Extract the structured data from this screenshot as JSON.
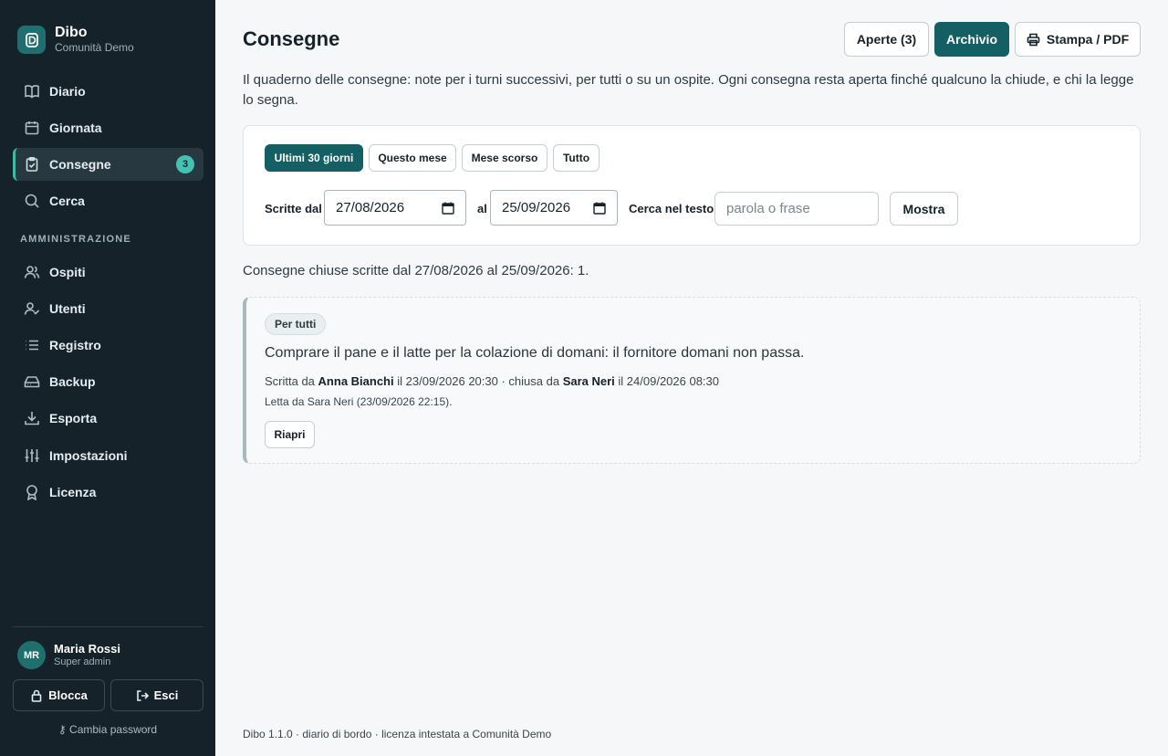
{
  "brand": {
    "name": "Dibo",
    "subtitle": "Comunità Demo"
  },
  "sidebar": {
    "items": [
      {
        "label": "Diario",
        "icon": "book-icon"
      },
      {
        "label": "Giornata",
        "icon": "calendar-icon"
      },
      {
        "label": "Consegne",
        "icon": "clipboard-check-icon",
        "badge": "3",
        "active": true
      },
      {
        "label": "Cerca",
        "icon": "search-icon"
      }
    ],
    "admin_section": "AMMINISTRAZIONE",
    "admin_items": [
      {
        "label": "Ospiti",
        "icon": "users-icon"
      },
      {
        "label": "Utenti",
        "icon": "user-check-icon"
      },
      {
        "label": "Registro",
        "icon": "list-icon"
      },
      {
        "label": "Backup",
        "icon": "hard-drive-icon"
      },
      {
        "label": "Esporta",
        "icon": "download-icon"
      },
      {
        "label": "Impostazioni",
        "icon": "sliders-icon"
      },
      {
        "label": "Licenza",
        "icon": "award-icon"
      }
    ]
  },
  "user": {
    "initials": "MR",
    "name": "Maria Rossi",
    "role": "Super admin"
  },
  "sidebar_actions": {
    "lock": "Blocca",
    "logout": "Esci",
    "change_password": "Cambia password"
  },
  "header": {
    "title": "Consegne",
    "open_button": "Aperte (3)",
    "archive_button": "Archivio",
    "print_button": "Stampa / PDF"
  },
  "intro": "Il quaderno delle consegne: note per i turni successivi, per tutti o su un ospite. Ogni consegna resta aperta finché qualcuno la chiude, e chi la legge lo segna.",
  "filters": {
    "ranges": [
      "Ultimi 30 giorni",
      "Questo mese",
      "Mese scorso",
      "Tutto"
    ],
    "active_range": "Ultimi 30 giorni",
    "from_label": "Scritte dal",
    "from_value": "27/08/2026",
    "to_label": "al",
    "to_value": "25/09/2026",
    "search_label": "Cerca nel testo",
    "search_placeholder": "parola o frase",
    "show_button": "Mostra"
  },
  "summary": "Consegne chiuse scritte dal 27/08/2026 al 25/09/2026: 1.",
  "notes": [
    {
      "tag": "Per tutti",
      "text": "Comprare il pane e il latte per la colazione di domani: il fornitore domani non passa.",
      "meta_written_prefix": "Scritta da",
      "author": "Anna Bianchi",
      "written_at": "il 23/09/2026 20:30 · chiusa da",
      "closed_by": "Sara Neri",
      "closed_at": "il 24/09/2026 08:30",
      "read_by": "Letta da Sara Neri (23/09/2026 22:15).",
      "reopen_button": "Riapri"
    }
  ],
  "footer": "Dibo 1.1.0 · diario di bordo · licenza intestata a Comunità Demo",
  "colors": {
    "sidebar_bg": "#16222a",
    "accent": "#145f63",
    "badge": "#45c1b1",
    "page_bg": "#f5f7f8"
  }
}
